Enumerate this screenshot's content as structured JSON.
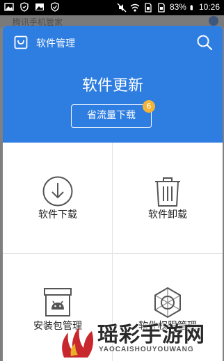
{
  "status_bar": {
    "battery": "83%",
    "time": "10:26"
  },
  "background": {
    "obscured_text": "腾讯手机管家"
  },
  "dialog": {
    "title": "软件管理",
    "update_heading": "软件更新",
    "save_data_button": "省流量下载",
    "update_count": "6"
  },
  "grid": [
    {
      "label": "软件下载",
      "icon": "download-icon"
    },
    {
      "label": "软件卸载",
      "icon": "trash-icon"
    },
    {
      "label": "安装包管理",
      "icon": "android-box-icon"
    },
    {
      "label": "软件权限管理",
      "icon": "permission-hexagon-icon"
    }
  ],
  "watermark": {
    "name": "瑶彩手游网",
    "sub": "YAOCAISHOUYOUWANG"
  },
  "colors": {
    "header_blue": "#2e7de1",
    "badge": "#f3b43a",
    "icon_gray": "#555555"
  }
}
